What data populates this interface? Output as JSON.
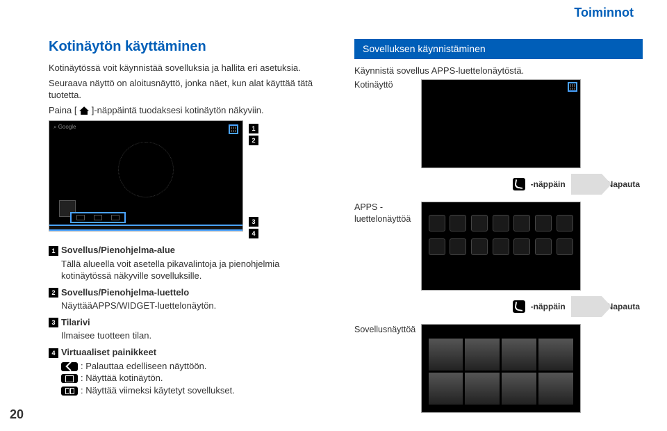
{
  "header": {
    "section_title": "Toiminnot"
  },
  "page_number": "20",
  "left": {
    "title": "Kotinäytön käyttäminen",
    "p1": "Kotinäytössä voit käynnistää sovelluksia ja hallita eri asetuksia.",
    "p2": "Seuraava näyttö on aloitusnäyttö, jonka näet, kun alat käyttää tätä tuotetta.",
    "p3_pre": "Paina [ ",
    "p3_post": " ]-näppäintä tuodaksesi kotinäytön näkyviin.",
    "callouts": {
      "n1": "1",
      "n2": "2",
      "n3": "3",
      "n4": "4"
    },
    "legend": {
      "i1_title": "Sovellus/Pienohjelma-alue",
      "i1_desc": "Tällä alueella voit asetella pikavalintoja ja pienohjelmia kotinäytössä näkyville sovelluksille.",
      "i2_title": "Sovellus/Pienohjelma-luettelo",
      "i2_desc": "NäyttääAPPS/WIDGET-luettelonäytön.",
      "i3_title": "Tilarivi",
      "i3_desc": "Ilmaisee tuotteen tilan.",
      "i4_title": "Virtuaaliset painikkeet",
      "i4_back": ": Palauttaa edelliseen näyttöön.",
      "i4_home": ": Näyttää kotinäytön.",
      "i4_recent": ": Näyttää viimeksi käytetyt sovellukset."
    }
  },
  "right": {
    "bar": "Sovelluksen käynnistäminen",
    "intro": "Käynnistä sovellus APPS-luettelonäytöstä.",
    "label1": "Kotinäyttö",
    "label2_a": "APPS -",
    "label2_b": "luettelonäyttöä",
    "label3": "Sovellusnäyttöä",
    "act_back": "-näppäin",
    "act_tap": "Napauta"
  }
}
